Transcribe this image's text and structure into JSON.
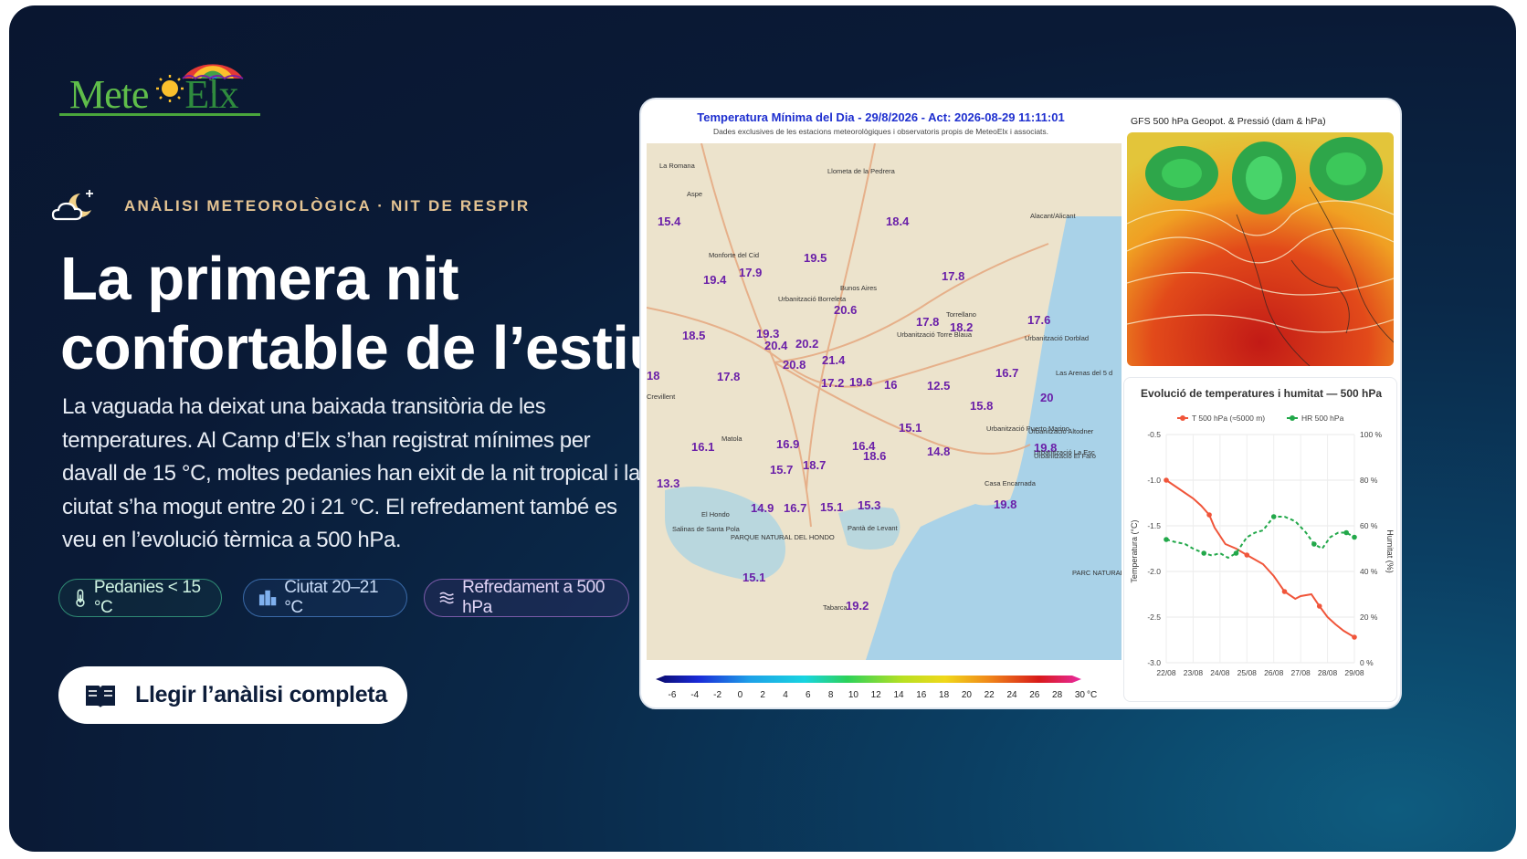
{
  "brand": {
    "logo_text_a": "Mete",
    "logo_text_b": "Elx"
  },
  "kicker": "ANÀLISI METEOROLÒGICA · NIT DE RESPIR",
  "headline_line1": "La primera nit",
  "headline_line2": "confortable de l’estiu",
  "lead": "La vaguada ha deixat una baixada transitòria de les temperatures. Al Camp d’Elx s’han registrat mínimes per davall de 15 °C, moltes pedanies han eixit de la nit tropical i la ciutat s’ha mogut entre 20 i 21 °C. El refredament també es veu en l’evolució tèrmica a 500 hPa.",
  "chips": [
    {
      "label": "Pedanies < 15 °C",
      "icon": "thermometer-icon"
    },
    {
      "label": "Ciutat 20–21 °C",
      "icon": "city-icon"
    },
    {
      "label": "Refredament a 500 hPa",
      "icon": "wind-icon"
    }
  ],
  "cta": {
    "label": "Llegir l’anàlisi completa",
    "icon": "book-icon"
  },
  "map": {
    "title": "Temperatura Mínima del Dia - 29/8/2026 - Act:  2026-08-29 11:11:01",
    "subtitle": "Dades exclusives de les estacions meteorològiques i observatoris propis de MeteoElx i associats.",
    "places": [
      "La Romana",
      "Aspe",
      "Llometa de la Pedrera",
      "Alacant/Alicant",
      "Monforte del Cid",
      "Bunos Aires",
      "Urbanització Borreleta",
      "Torrellano",
      "Urbanització Torre Blaua",
      "Urbanització Dorblad",
      "Crevillent",
      "Las Arenas del 5 d",
      "Matola",
      "Urbanització Puerto Marino",
      "Urbanització Altodner",
      "Urbanització El Faro",
      "Casa Encarnada",
      "El Hondo",
      "Salinas de Santa Pola",
      "PARQUE NATURAL DEL HONDO",
      "Pantà de Levant",
      "PARC NATURAL DE LES SALINES DE SANTA POLA",
      "Tabarca",
      "Urbanització La Esc"
    ],
    "readings": [
      "15.4",
      "18.4",
      "19.5",
      "19.4",
      "17.9",
      "17.8",
      "20.6",
      "17.6",
      "18.5",
      "19.3",
      "20.4",
      "20.2",
      "17.8",
      "18.2",
      "18",
      "17.8",
      "20.8",
      "21.4",
      "16.7",
      "17.2",
      "19.6",
      "16",
      "12.5",
      "15.8",
      "20",
      "15.1",
      "16.1",
      "16.9",
      "16.4",
      "18.6",
      "14.8",
      "19.8",
      "13.3",
      "15.7",
      "18.7",
      "14.9",
      "16.7",
      "15.1",
      "15.3",
      "19.8",
      "15.1",
      "19.2"
    ],
    "scale_ticks": [
      "-6",
      "-4",
      "-2",
      "0",
      "2",
      "4",
      "6",
      "8",
      "10",
      "12",
      "14",
      "16",
      "18",
      "20",
      "22",
      "24",
      "26",
      "28",
      "30"
    ],
    "scale_unit": "°C"
  },
  "gfs": {
    "title": "GFS 500 hPa Geopot. & Pressió (dam & hPa)"
  },
  "evolution": {
    "title": "Evolució de temperatures i humitat — 500 hPa",
    "legend": [
      {
        "name": "T 500 hPa (≈5000 m)",
        "color": "#f0553a"
      },
      {
        "name": "HR 500 hPa",
        "color": "#22a84a"
      }
    ],
    "ylabel_left": "Temperatura (°C)",
    "ylabel_right": "Humitat (%)",
    "yticks_left": [
      "-0.5",
      "-1.0",
      "-1.5",
      "-2.0",
      "-2.5",
      "-3.0"
    ],
    "yticks_right": [
      "100 %",
      "80 %",
      "60 %",
      "40 %",
      "20 %",
      "0 %"
    ],
    "xticks": [
      "22/08",
      "23/08",
      "24/08",
      "25/08",
      "26/08",
      "27/08",
      "28/08",
      "29/08"
    ]
  },
  "chart_data": {
    "type": "line",
    "title": "Evolució de temperatures i humitat — 500 hPa",
    "x": [
      "22/08",
      "23/08",
      "24/08",
      "25/08",
      "26/08",
      "27/08",
      "28/08",
      "29/08"
    ],
    "series": [
      {
        "name": "T 500 hPa (≈5000 m)",
        "axis": "left",
        "color": "#f0553a",
        "x": [
          0,
          0.5,
          1,
          1.3,
          1.6,
          1.8,
          2.2,
          2.6,
          3,
          3.3,
          3.6,
          4,
          4.4,
          4.8,
          5,
          5.4,
          5.7,
          6,
          6.3,
          6.6,
          7
        ],
        "values": [
          -1.0,
          -1.1,
          -1.2,
          -1.28,
          -1.38,
          -1.52,
          -1.7,
          -1.75,
          -1.82,
          -1.87,
          -1.92,
          -2.05,
          -2.22,
          -2.3,
          -2.27,
          -2.25,
          -2.38,
          -2.5,
          -2.58,
          -2.65,
          -2.72
        ]
      },
      {
        "name": "HR 500 hPa",
        "axis": "right",
        "color": "#22a84a",
        "x": [
          0,
          0.3,
          0.7,
          1,
          1.4,
          1.7,
          2,
          2.3,
          2.6,
          3,
          3.3,
          3.6,
          4,
          4.4,
          4.8,
          5.2,
          5.5,
          5.8,
          6.1,
          6.4,
          6.7,
          7
        ],
        "values": [
          54,
          53,
          52,
          50,
          48,
          47,
          48,
          46,
          48,
          55,
          57,
          58,
          64,
          64,
          62,
          57,
          52,
          50,
          55,
          57,
          57,
          55
        ]
      }
    ],
    "ylim_left": [
      -3.0,
      -0.5
    ],
    "ylim_right": [
      0,
      100
    ],
    "grid": true,
    "legend": "top"
  },
  "colors": {
    "background": "#0a1a36",
    "accent": "#e5c493",
    "cta_bg": "#ffffff"
  }
}
